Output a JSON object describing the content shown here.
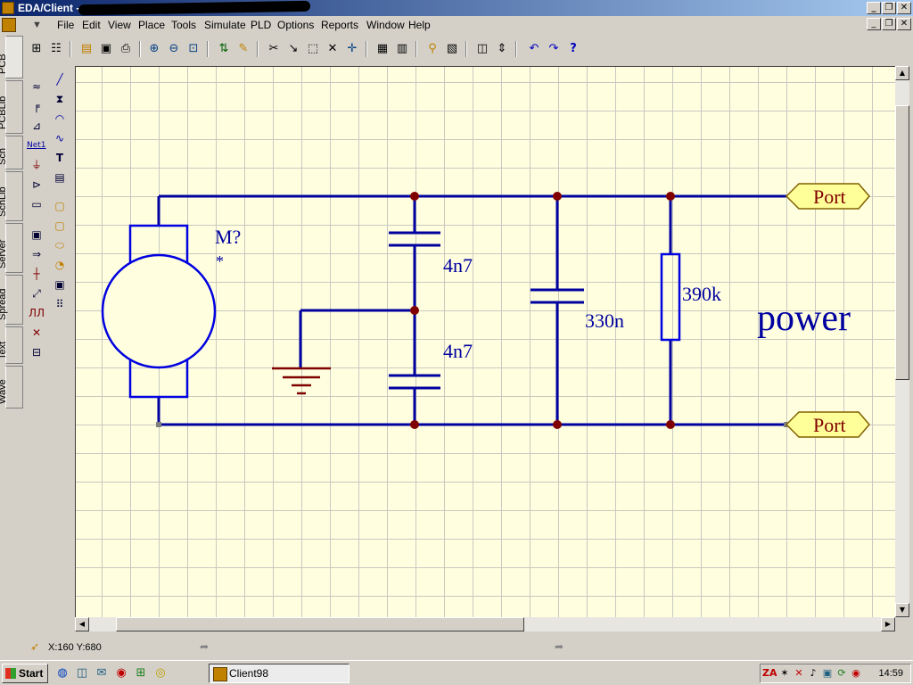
{
  "window": {
    "title": "EDA/Client -"
  },
  "menu": [
    "File",
    "Edit",
    "View",
    "Place",
    "Tools",
    "Simulate",
    "PLD",
    "Options",
    "Reports",
    "Window",
    "Help"
  ],
  "left_tabs": [
    "PCB",
    "PCBLib",
    "Sch",
    "SchLib",
    "Server",
    "Spread",
    "Text",
    "Wave"
  ],
  "schematic": {
    "motor_designator": "M?",
    "motor_value": "*",
    "cap1_value": "4n7",
    "cap2_value": "4n7",
    "cap3_value": "330n",
    "resistor_value": "390k",
    "port_top": "Port",
    "port_bottom": "Port",
    "net_label": "power",
    "colors": {
      "wire": "#0000a0",
      "junction": "#800000",
      "ground": "#800000",
      "port_fill": "#ffff99"
    }
  },
  "status": {
    "coords": "X:160 Y:680"
  },
  "taskbar": {
    "start_label": "Start",
    "task_label": "Client98",
    "clock": "14:59"
  }
}
